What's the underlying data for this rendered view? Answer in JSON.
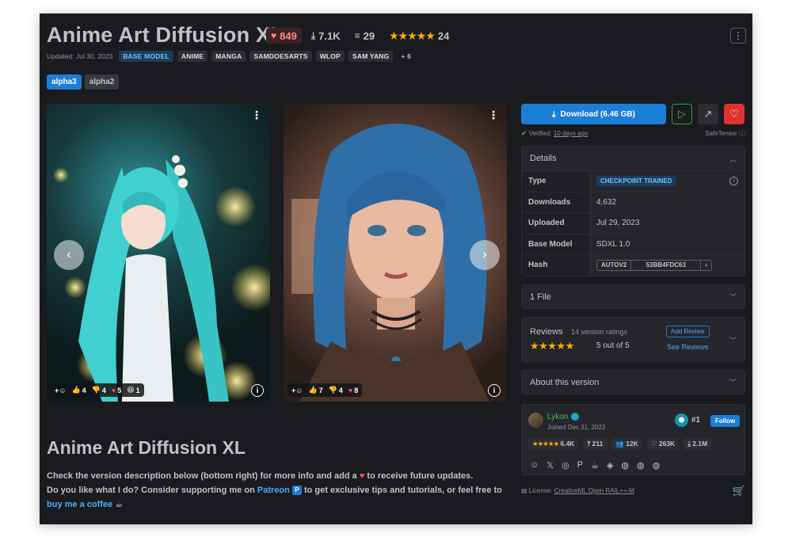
{
  "model": {
    "title": "Anime Art Diffusion XL",
    "likes": "849",
    "downloads": "7.1K",
    "comments": "29",
    "rating_count": "24",
    "rating_stars": "★★★★★",
    "updated": "Updated: Jul 30, 2023",
    "base_model_badge": "BASE MODEL",
    "tags": [
      "ANIME",
      "MANGA",
      "SAMDOESARTS",
      "WLOP",
      "SAM YANG"
    ],
    "more_tags": "+ 6"
  },
  "versions": [
    "alpha3",
    "alpha2"
  ],
  "gallery": [
    {
      "reactions": {
        "like": "4",
        "dislike": "4",
        "heart": "5",
        "laugh": "1"
      }
    },
    {
      "reactions": {
        "like": "7",
        "dislike": "4",
        "heart": "8"
      }
    }
  ],
  "description": {
    "title": "Anime Art Diffusion XL",
    "line1_a": "Check the version description below (bottom right) for more info and add a",
    "line1_b": "to receive future updates.",
    "line2_a": "Do you like what I do? Consider supporting me on",
    "patreon": "Patreon",
    "line2_b": "to get exclusive tips and tutorials, or feel free to",
    "coffee": "buy me a coffee"
  },
  "sidebar": {
    "download_label": "Download (6.46 GB)",
    "verified_label": "Verified:",
    "verified_time": "10 days ago",
    "safetensor": "SafeTensor",
    "details_title": "Details",
    "details": {
      "type_key": "Type",
      "type_val": "CHECKPOINT TRAINED",
      "downloads_key": "Downloads",
      "downloads_val": "4,632",
      "uploaded_key": "Uploaded",
      "uploaded_val": "Jul 29, 2023",
      "base_key": "Base Model",
      "base_val": "SDXL 1.0",
      "hash_key": "Hash",
      "hash_type": "AUTOV2",
      "hash_val": "53BB4FDC63"
    },
    "files_title": "1 File",
    "reviews": {
      "title": "Reviews",
      "count": "14 version ratings",
      "stars": "★★★★★",
      "score": "5 out of 5",
      "add": "Add Review",
      "see": "See Reviews"
    },
    "about_title": "About this version",
    "creator": {
      "name": "Lykon",
      "joined": "Joined Dec 31, 2022",
      "rank": "#1",
      "follow": "Follow",
      "rating": "6.4K",
      "uploads": "211",
      "followers": "12K",
      "favorites": "263K",
      "downloads": "2.1M"
    },
    "license_label": "License:",
    "license_name": "CreativeML Open RAIL++-M"
  }
}
